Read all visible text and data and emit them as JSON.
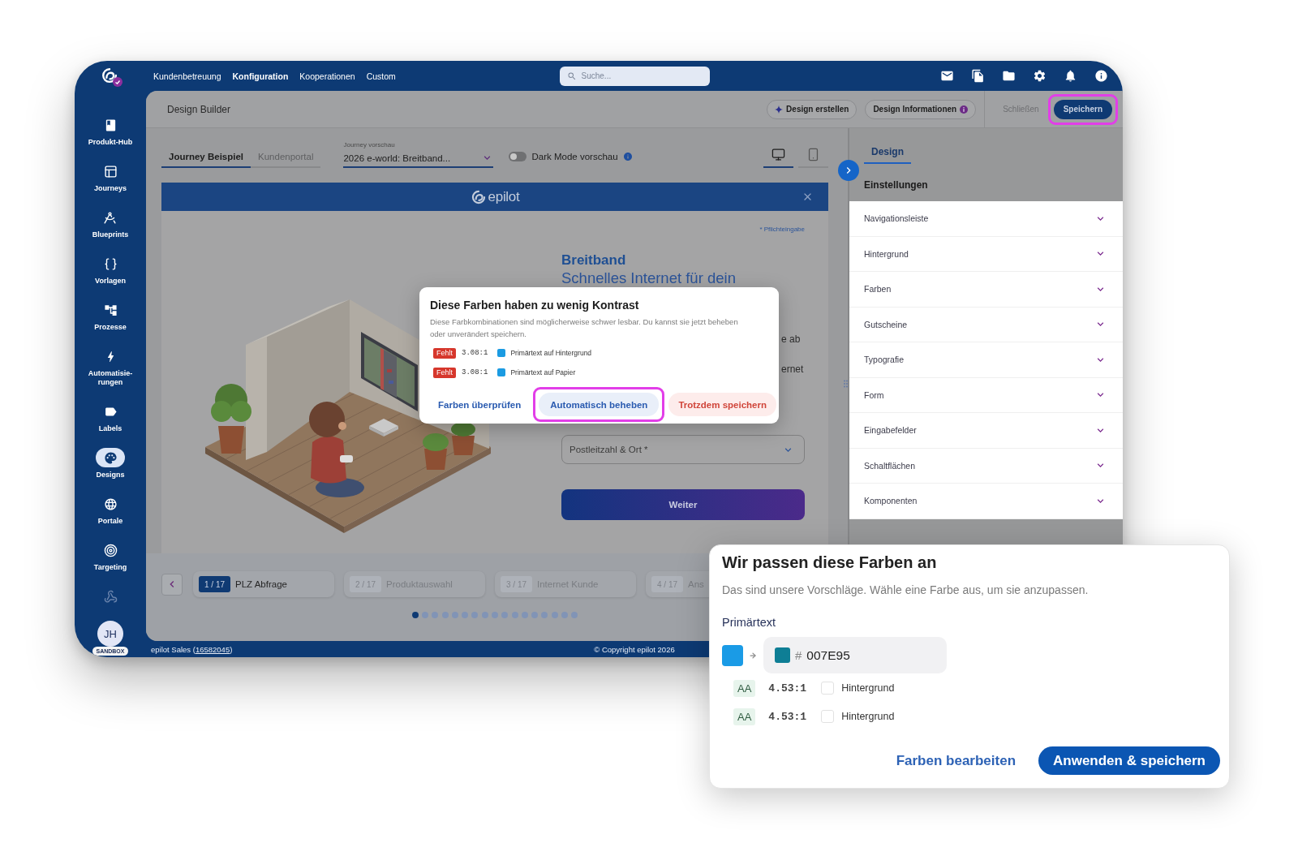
{
  "top_bar": {
    "nav": [
      {
        "label": "Kundenbetreuung",
        "selected": false
      },
      {
        "label": "Konfiguration",
        "selected": true
      },
      {
        "label": "Kooperationen",
        "selected": false
      },
      {
        "label": "Custom",
        "selected": false
      }
    ],
    "search": {
      "placeholder": "Suche..."
    }
  },
  "sidebar": {
    "items": [
      {
        "label": "Produkt-Hub",
        "selected": false
      },
      {
        "label": "Journeys",
        "selected": false
      },
      {
        "label": "Blueprints",
        "selected": false
      },
      {
        "label": "Vorlagen",
        "selected": false
      },
      {
        "label": "Prozesse",
        "selected": false
      },
      {
        "label": "Automatisie-rungen",
        "selected": false
      },
      {
        "label": "Labels",
        "selected": false
      },
      {
        "label": "Designs",
        "selected": true
      },
      {
        "label": "Portale",
        "selected": false
      },
      {
        "label": "Targeting",
        "selected": false
      }
    ],
    "user": {
      "initials": "JH",
      "badge": "SANDBOX"
    }
  },
  "header": {
    "title": "Design Builder",
    "buttons": [
      {
        "kind": "generate",
        "label": "Design erstellen",
        "disabled": false,
        "highlighted": false
      },
      {
        "kind": "info",
        "label": "Design Informationen",
        "disabled": false,
        "highlighted": false
      },
      {
        "kind": "text",
        "label": "Schließen",
        "disabled": true,
        "highlighted": false
      },
      {
        "kind": "primary",
        "label": "Speichern",
        "disabled": false,
        "highlighted": true
      }
    ]
  },
  "builder": {
    "tabs": [
      {
        "label": "Journey Beispiel",
        "selected": true
      },
      {
        "label": "Kundenportal",
        "selected": false
      }
    ],
    "journey_select": {
      "label": "Journey vorschau",
      "value": "2026 e-world: Breitband..."
    },
    "dark_mode": {
      "label": "Dark Mode vorschau",
      "on": false
    },
    "devices": [
      {
        "selected": true
      },
      {
        "selected": false
      }
    ]
  },
  "preview": {
    "logo_text": "epilot",
    "required_note": "* Pflichteingabe",
    "heading": "Breitband",
    "subheading": "Schnelles Internet für dein",
    "text_fragments": [
      "e ab",
      "ernet"
    ],
    "location_field": {
      "placeholder": "Postleitzahl & Ort *"
    },
    "submit_button": "Weiter"
  },
  "contrast_dialog": {
    "title": "Diese Farben haben zu wenig Kontrast",
    "description": "Diese Farbkombinationen sind möglicherweise schwer lesbar. Du kannst sie jetzt beheben oder unverändert speichern.",
    "issues": [
      {
        "status": "Fehlt",
        "ratio": "3.08:1",
        "color": "#1b9be2",
        "label": "Primärtext auf Hintergrund"
      },
      {
        "status": "Fehlt",
        "ratio": "3.08:1",
        "color": "#1b9be2",
        "label": "Primärtext auf Papier"
      }
    ],
    "actions": [
      {
        "kind": "link",
        "label": "Farben überprüfen",
        "highlighted": false
      },
      {
        "kind": "soft",
        "label": "Automatisch beheben",
        "highlighted": true
      },
      {
        "kind": "danger",
        "label": "Trotzdem speichern",
        "highlighted": false
      }
    ]
  },
  "settings_panel": {
    "tabs": [
      {
        "label": "Design",
        "selected": true
      }
    ],
    "section_title": "Einstellungen",
    "items": [
      {
        "label": "Navigationsleiste",
        "expanded": false
      },
      {
        "label": "Hintergrund",
        "expanded": false
      },
      {
        "label": "Farben",
        "expanded": false
      },
      {
        "label": "Gutscheine",
        "expanded": false
      },
      {
        "label": "Typografie",
        "expanded": false
      },
      {
        "label": "Form",
        "expanded": false
      },
      {
        "label": "Eingabefelder",
        "expanded": false
      },
      {
        "label": "Schaltflächen",
        "expanded": false
      },
      {
        "label": "Komponenten",
        "expanded": false
      }
    ]
  },
  "stepper": {
    "steps": [
      {
        "number": "1 / 17",
        "label": "PLZ Abfrage",
        "selected": true
      },
      {
        "number": "2 / 17",
        "label": "Produktauswahl",
        "selected": false
      },
      {
        "number": "3 / 17",
        "label": "Internet Kunde",
        "selected": false
      },
      {
        "number": "4 / 17",
        "label": "Ans",
        "selected": false
      }
    ],
    "dots": [
      {
        "selected": true
      },
      {
        "selected": false
      },
      {
        "selected": false
      },
      {
        "selected": false
      },
      {
        "selected": false
      },
      {
        "selected": false
      },
      {
        "selected": false
      },
      {
        "selected": false
      },
      {
        "selected": false
      },
      {
        "selected": false
      },
      {
        "selected": false
      },
      {
        "selected": false
      },
      {
        "selected": false
      },
      {
        "selected": false
      },
      {
        "selected": false
      },
      {
        "selected": false
      },
      {
        "selected": false
      }
    ]
  },
  "footer": {
    "account_prefix": "epilot Sales (",
    "account_id": "16582045",
    "account_suffix": ")",
    "copyright": "© Copyright epilot 2026"
  },
  "suggestion_popup": {
    "title": "Wir passen diese Farben an",
    "description": "Das sind unsere Vorschläge. Wähle eine Farbe aus, um sie anzupassen.",
    "groups": [
      {
        "label": "Primärtext",
        "from": {
          "color": "#1a9be6"
        },
        "to": {
          "color": "#0e7e95",
          "prefix": "#",
          "value": "007E95"
        },
        "checks": [
          {
            "grade": "AA",
            "ratio": "4.53:1",
            "color": "#ffffff",
            "label": "Hintergrund"
          },
          {
            "grade": "AA",
            "ratio": "4.53:1",
            "color": "#ffffff",
            "label": "Hintergrund"
          }
        ]
      }
    ],
    "actions": [
      {
        "kind": "link",
        "label": "Farben bearbeiten"
      },
      {
        "kind": "primary",
        "label": "Anwenden & speichern"
      }
    ]
  }
}
